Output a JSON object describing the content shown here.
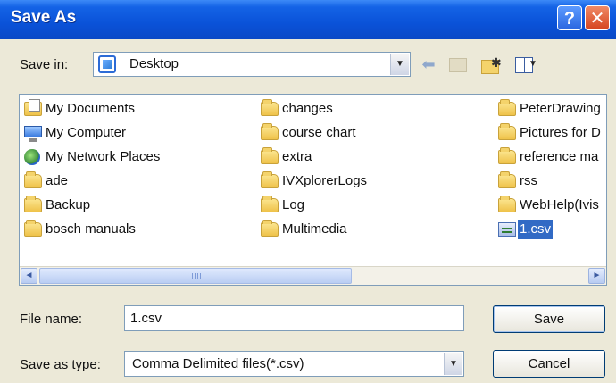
{
  "window": {
    "title": "Save As",
    "help_glyph": "?",
    "close_glyph": "✕"
  },
  "toolbar": {
    "save_in_label": "Save in:",
    "save_in_value": "Desktop",
    "icons": [
      "desktop-icon",
      "back-icon",
      "up-folder-icon",
      "new-folder-icon",
      "views-menu-icon"
    ]
  },
  "file_list": {
    "items": [
      {
        "label": "My Documents",
        "icon": "documents-icon"
      },
      {
        "label": "My Computer",
        "icon": "computer-icon"
      },
      {
        "label": "My Network Places",
        "icon": "network-icon"
      },
      {
        "label": "ade",
        "icon": "folder-icon"
      },
      {
        "label": "Backup",
        "icon": "folder-icon"
      },
      {
        "label": "bosch manuals",
        "icon": "folder-icon"
      },
      {
        "label": "changes",
        "icon": "folder-icon"
      },
      {
        "label": "course chart",
        "icon": "folder-icon"
      },
      {
        "label": "extra",
        "icon": "folder-icon"
      },
      {
        "label": "IVXplorerLogs",
        "icon": "folder-icon"
      },
      {
        "label": "Log",
        "icon": "folder-icon"
      },
      {
        "label": "Multimedia",
        "icon": "folder-icon"
      },
      {
        "label": "PeterDrawing",
        "icon": "folder-icon"
      },
      {
        "label": "Pictures for D",
        "icon": "folder-icon"
      },
      {
        "label": "reference ma",
        "icon": "folder-icon"
      },
      {
        "label": "rss",
        "icon": "folder-icon"
      },
      {
        "label": "WebHelp(Ivis",
        "icon": "folder-icon"
      },
      {
        "label": "1.csv",
        "icon": "csv-icon",
        "selected": true
      }
    ],
    "scroll_left_glyph": "◄",
    "scroll_right_glyph": "►"
  },
  "form": {
    "file_name_label": "File name:",
    "file_name_value": "1.csv",
    "save_as_type_label": "Save as type:",
    "save_as_type_value": "Comma Delimited files(*.csv)"
  },
  "buttons": {
    "save": "Save",
    "cancel": "Cancel"
  },
  "colors": {
    "titlebar": "#0a52d8",
    "selection": "#316ac5",
    "dialog_bg": "#ece9d8"
  }
}
